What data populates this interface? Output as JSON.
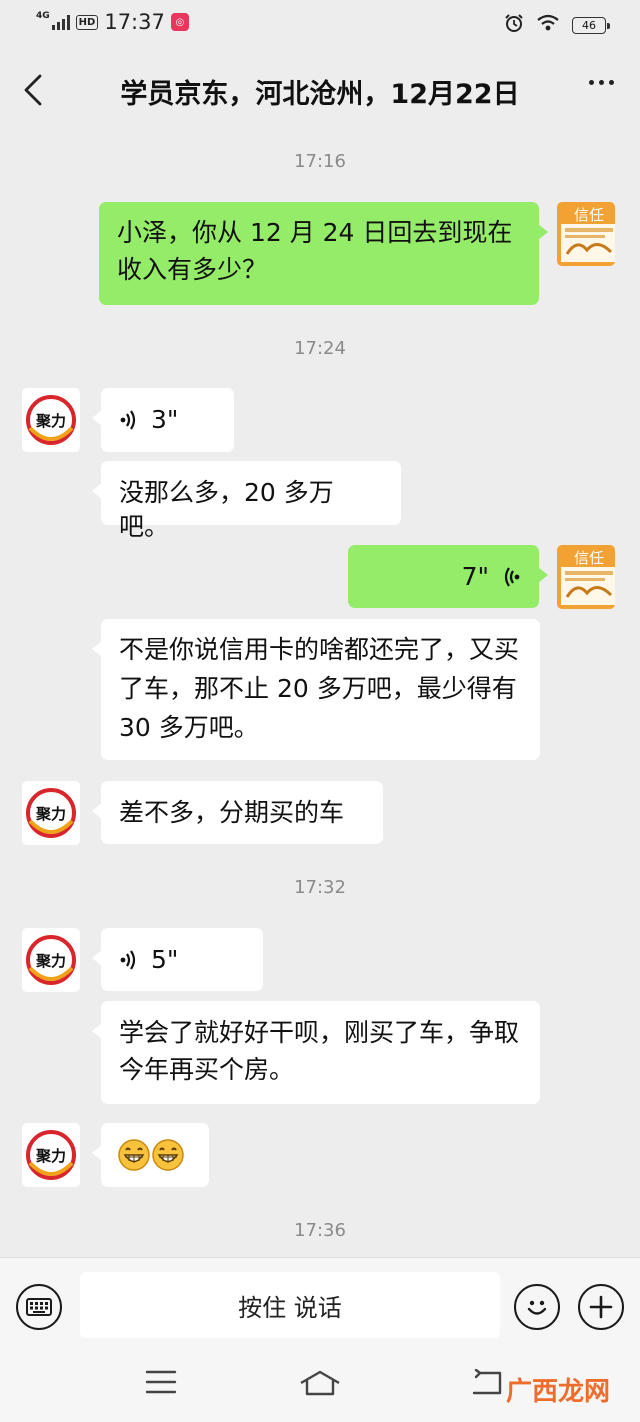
{
  "status_bar": {
    "network": "4G",
    "hd": "HD",
    "time": "17:37",
    "battery": "46",
    "app_icon": "store-app-icon"
  },
  "header": {
    "title": "学员京东，河北沧州，12月22日"
  },
  "timestamps": [
    "17:16",
    "17:24",
    "17:32",
    "17:36"
  ],
  "messages": {
    "m1": {
      "side": "out",
      "text": "小泽，你从 12 月 24 日回去到现在收入有多少？"
    },
    "m2": {
      "side": "in",
      "type": "voice",
      "duration": "3\""
    },
    "m3": {
      "side": "in",
      "text": "没那么多，20 多万吧。"
    },
    "m4": {
      "side": "out",
      "type": "voice",
      "duration": "7\""
    },
    "m5": {
      "side": "in",
      "text": "不是你说信用卡的啥都还完了，又买了车，那不止 20 多万吧，最少得有 30 多万吧。"
    },
    "m6": {
      "side": "in",
      "text": "差不多，分期买的车"
    },
    "m7": {
      "side": "in",
      "type": "voice",
      "duration": "5\""
    },
    "m8": {
      "side": "in",
      "text": "学会了就好好干呗，刚买了车，争取今年再买个房。"
    },
    "m9": {
      "side": "in",
      "type": "emoji",
      "text": "😁😁"
    }
  },
  "avatars": {
    "self_label": "信任",
    "other_label": "聚力"
  },
  "input_bar": {
    "hold_to_talk": "按住 说话"
  },
  "watermark": "广西龙网",
  "colors": {
    "background": "#ededed",
    "incoming_bubble": "#ffffff",
    "outgoing_bubble": "#95ec69",
    "timestamp": "#8a8a8a",
    "watermark": "#ef6c2b"
  }
}
